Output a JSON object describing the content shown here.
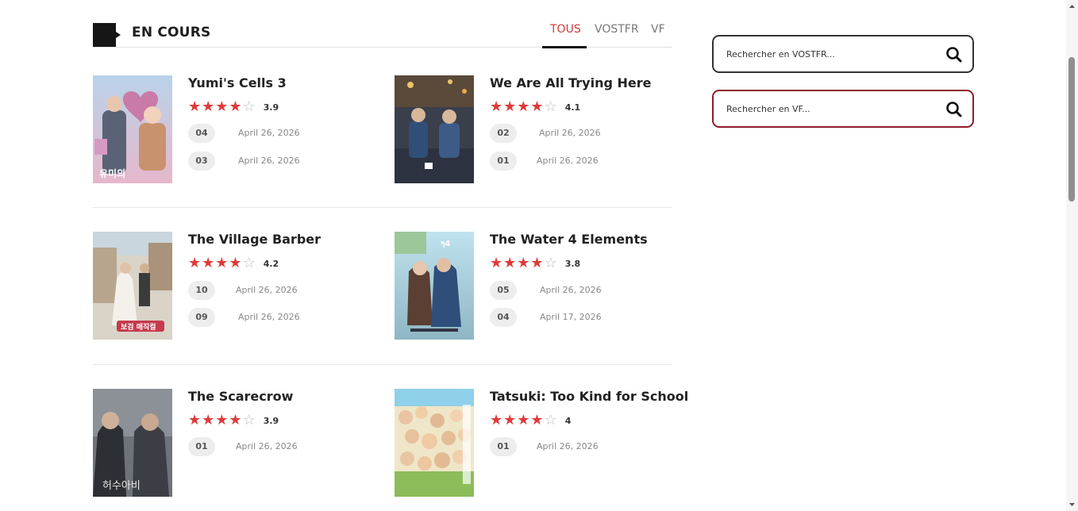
{
  "section": {
    "title": "EN COURS"
  },
  "tabs": [
    {
      "label": "TOUS",
      "active": true
    },
    {
      "label": "VOSTFR",
      "active": false
    },
    {
      "label": "VF",
      "active": false
    }
  ],
  "shows": [
    {
      "title": "Yumi's Cells 3",
      "rating": "3.9",
      "stars": 4,
      "episodes": [
        {
          "num": "04",
          "date": "April 26, 2026"
        },
        {
          "num": "03",
          "date": "April 26, 2026"
        }
      ]
    },
    {
      "title": "We Are All Trying Here",
      "rating": "4.1",
      "stars": 4,
      "episodes": [
        {
          "num": "02",
          "date": "April 26, 2026"
        },
        {
          "num": "01",
          "date": "April 26, 2026"
        }
      ]
    },
    {
      "title": "The Village Barber",
      "rating": "4.2",
      "stars": 4,
      "episodes": [
        {
          "num": "10",
          "date": "April 26, 2026"
        },
        {
          "num": "09",
          "date": "April 26, 2026"
        }
      ]
    },
    {
      "title": "The Water 4 Elements",
      "rating": "3.8",
      "stars": 4,
      "episodes": [
        {
          "num": "05",
          "date": "April 26, 2026"
        },
        {
          "num": "04",
          "date": "April 17, 2026"
        }
      ]
    },
    {
      "title": "The Scarecrow",
      "rating": "3.9",
      "stars": 4,
      "episodes": [
        {
          "num": "01",
          "date": "April 26, 2026"
        }
      ]
    },
    {
      "title": "Tatsuki: Too Kind for School",
      "rating": "4",
      "stars": 4,
      "episodes": [
        {
          "num": "01",
          "date": "April 26, 2026"
        }
      ]
    }
  ],
  "search": {
    "vostfr_placeholder": "Rechercher en VOSTFR...",
    "vf_placeholder": "Rechercher en VF..."
  },
  "colors": {
    "accent": "#d23a3a",
    "star": "#e03a3a",
    "vf_border": "#8e1d2a",
    "vostfr_border": "#333333"
  },
  "icons": {
    "search": "search-icon",
    "star": "star-icon",
    "section": "section-marker-icon"
  }
}
